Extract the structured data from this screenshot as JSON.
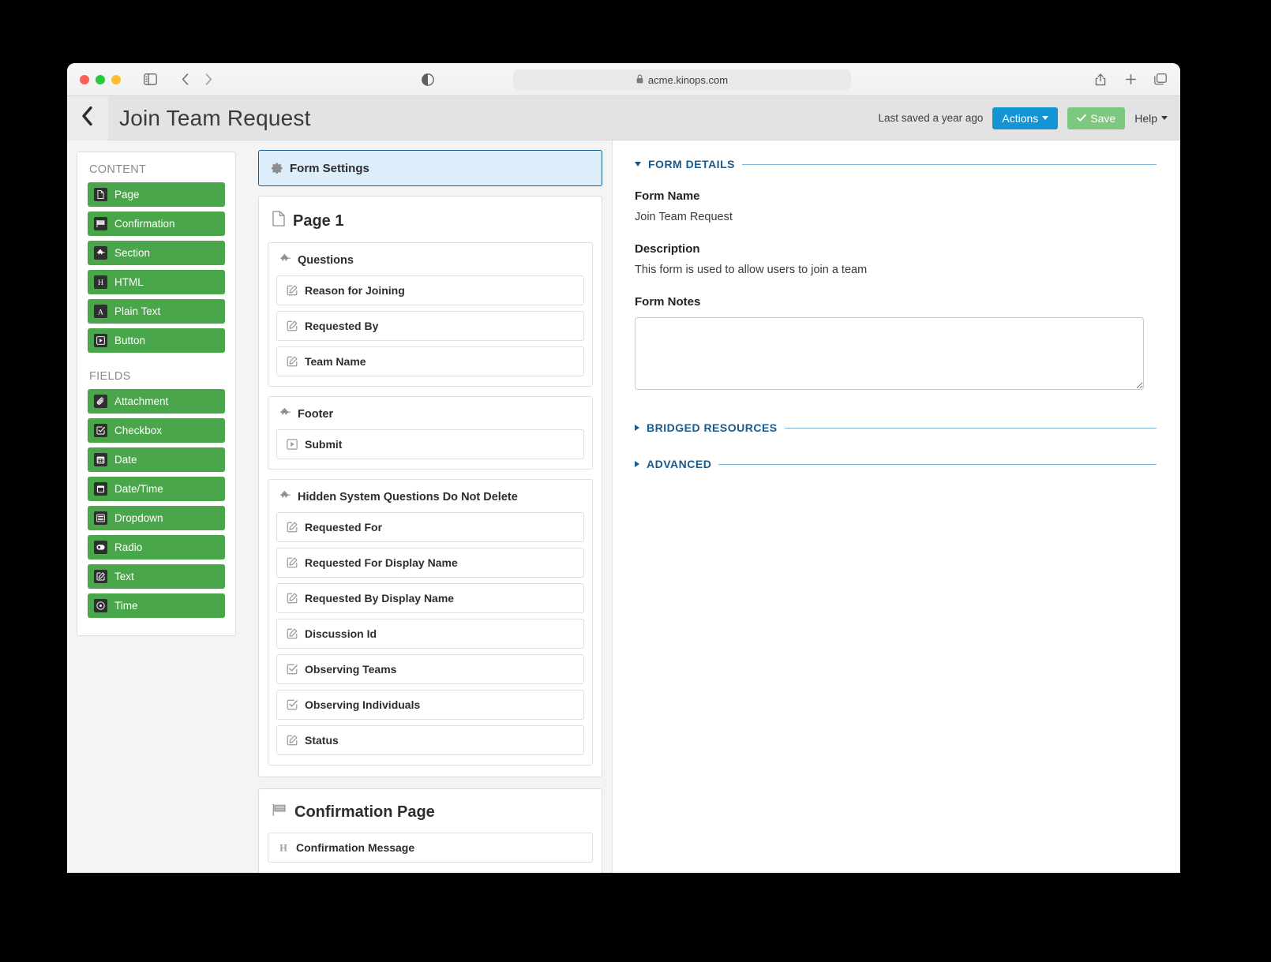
{
  "browser": {
    "url": "acme.kinops.com",
    "lock_icon": "lock-icon",
    "sidebar_icon": "sidebar-toggle-icon",
    "back_icon": "browser-back-icon",
    "forward_icon": "browser-forward-icon",
    "reader_icon": "reader-view-icon",
    "share_icon": "share-icon",
    "new_tab_icon": "new-tab-icon",
    "tabs_icon": "show-tabs-icon"
  },
  "header": {
    "back_icon": "chevron-left-icon",
    "title": "Join Team Request",
    "saved_status": "Last saved a year ago",
    "actions_label": "Actions",
    "save_label": "Save",
    "help_label": "Help"
  },
  "palette": {
    "content_heading": "CONTENT",
    "content_items": [
      {
        "label": "Page",
        "icon": "page-icon"
      },
      {
        "label": "Confirmation",
        "icon": "flag-icon"
      },
      {
        "label": "Section",
        "icon": "puzzle-icon"
      },
      {
        "label": "HTML",
        "icon": "html-icon"
      },
      {
        "label": "Plain Text",
        "icon": "text-a-icon"
      },
      {
        "label": "Button",
        "icon": "play-button-icon"
      }
    ],
    "fields_heading": "FIELDS",
    "field_items": [
      {
        "label": "Attachment",
        "icon": "paperclip-icon"
      },
      {
        "label": "Checkbox",
        "icon": "checkbox-icon"
      },
      {
        "label": "Date",
        "icon": "calendar-icon"
      },
      {
        "label": "Date/Time",
        "icon": "calendar-clock-icon"
      },
      {
        "label": "Dropdown",
        "icon": "list-icon"
      },
      {
        "label": "Radio",
        "icon": "radio-icon"
      },
      {
        "label": "Text",
        "icon": "pencil-square-icon"
      },
      {
        "label": "Time",
        "icon": "clock-icon"
      }
    ]
  },
  "builder": {
    "form_settings_label": "Form Settings",
    "form_settings_icon": "gear-icon",
    "page": {
      "title": "Page 1",
      "icon": "page-icon",
      "sections": [
        {
          "title": "Questions",
          "icon": "puzzle-icon",
          "elements": [
            {
              "label": "Reason for Joining",
              "icon": "pencil-square-icon"
            },
            {
              "label": "Requested By",
              "icon": "pencil-square-icon"
            },
            {
              "label": "Team Name",
              "icon": "pencil-square-icon"
            }
          ]
        },
        {
          "title": "Footer",
          "icon": "puzzle-icon",
          "elements": [
            {
              "label": "Submit",
              "icon": "play-button-icon"
            }
          ]
        },
        {
          "title": "Hidden System Questions Do Not Delete",
          "icon": "puzzle-icon",
          "elements": [
            {
              "label": "Requested For",
              "icon": "pencil-square-icon"
            },
            {
              "label": "Requested For Display Name",
              "icon": "pencil-square-icon"
            },
            {
              "label": "Requested By Display Name",
              "icon": "pencil-square-icon"
            },
            {
              "label": "Discussion Id",
              "icon": "pencil-square-icon"
            },
            {
              "label": "Observing Teams",
              "icon": "checkbox-icon"
            },
            {
              "label": "Observing Individuals",
              "icon": "checkbox-icon"
            },
            {
              "label": "Status",
              "icon": "pencil-square-icon"
            }
          ]
        }
      ]
    },
    "confirmation": {
      "title": "Confirmation Page",
      "icon": "flag-icon",
      "elements": [
        {
          "label": "Confirmation Message",
          "icon": "html-icon"
        }
      ]
    }
  },
  "details": {
    "form_details_label": "FORM DETAILS",
    "form_name_label": "Form Name",
    "form_name_value": "Join Team Request",
    "description_label": "Description",
    "description_value": "This form is used to allow users to join a team",
    "form_notes_label": "Form Notes",
    "form_notes_value": "",
    "form_notes_placeholder": "",
    "bridged_resources_label": "BRIDGED RESOURCES",
    "advanced_label": "ADVANCED"
  },
  "colors": {
    "accent_blue": "#1494d2",
    "save_green": "#7ec77e",
    "palette_green": "#4aa64a",
    "heading_blue": "#1a5a8a",
    "selected_bg": "#ddeefb"
  }
}
